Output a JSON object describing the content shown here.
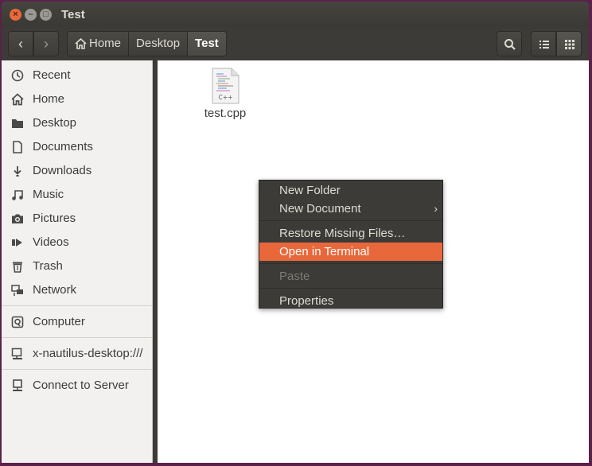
{
  "window": {
    "title": "Test"
  },
  "breadcrumbs": [
    "Home",
    "Desktop",
    "Test"
  ],
  "sidebar": {
    "items": [
      {
        "label": "Recent",
        "icon": "clock-icon"
      },
      {
        "label": "Home",
        "icon": "home-icon"
      },
      {
        "label": "Desktop",
        "icon": "folder-icon"
      },
      {
        "label": "Documents",
        "icon": "document-icon"
      },
      {
        "label": "Downloads",
        "icon": "download-icon"
      },
      {
        "label": "Music",
        "icon": "music-icon"
      },
      {
        "label": "Pictures",
        "icon": "camera-icon"
      },
      {
        "label": "Videos",
        "icon": "video-icon"
      },
      {
        "label": "Trash",
        "icon": "trash-icon"
      },
      {
        "label": "Network",
        "icon": "network-icon"
      },
      {
        "label": "Computer",
        "icon": "drive-icon"
      },
      {
        "label": "x-nautilus-desktop:///",
        "icon": "network-drive-icon"
      },
      {
        "label": "Connect to Server",
        "icon": "server-icon"
      }
    ]
  },
  "files": [
    {
      "name": "test.cpp",
      "icon": "cpp-file-icon",
      "icon_text": "C++"
    }
  ],
  "context_menu": {
    "items": [
      {
        "label": "New Folder"
      },
      {
        "label": "New Document",
        "submenu": true
      },
      {
        "label": "Restore Missing Files…"
      },
      {
        "label": "Open in Terminal",
        "highlighted": true
      },
      {
        "label": "Paste",
        "disabled": true
      },
      {
        "label": "Properties"
      }
    ]
  },
  "colors": {
    "accent": "#e9683b",
    "titlebar": "#3c3b37",
    "sidebar": "#f2f1f0"
  }
}
